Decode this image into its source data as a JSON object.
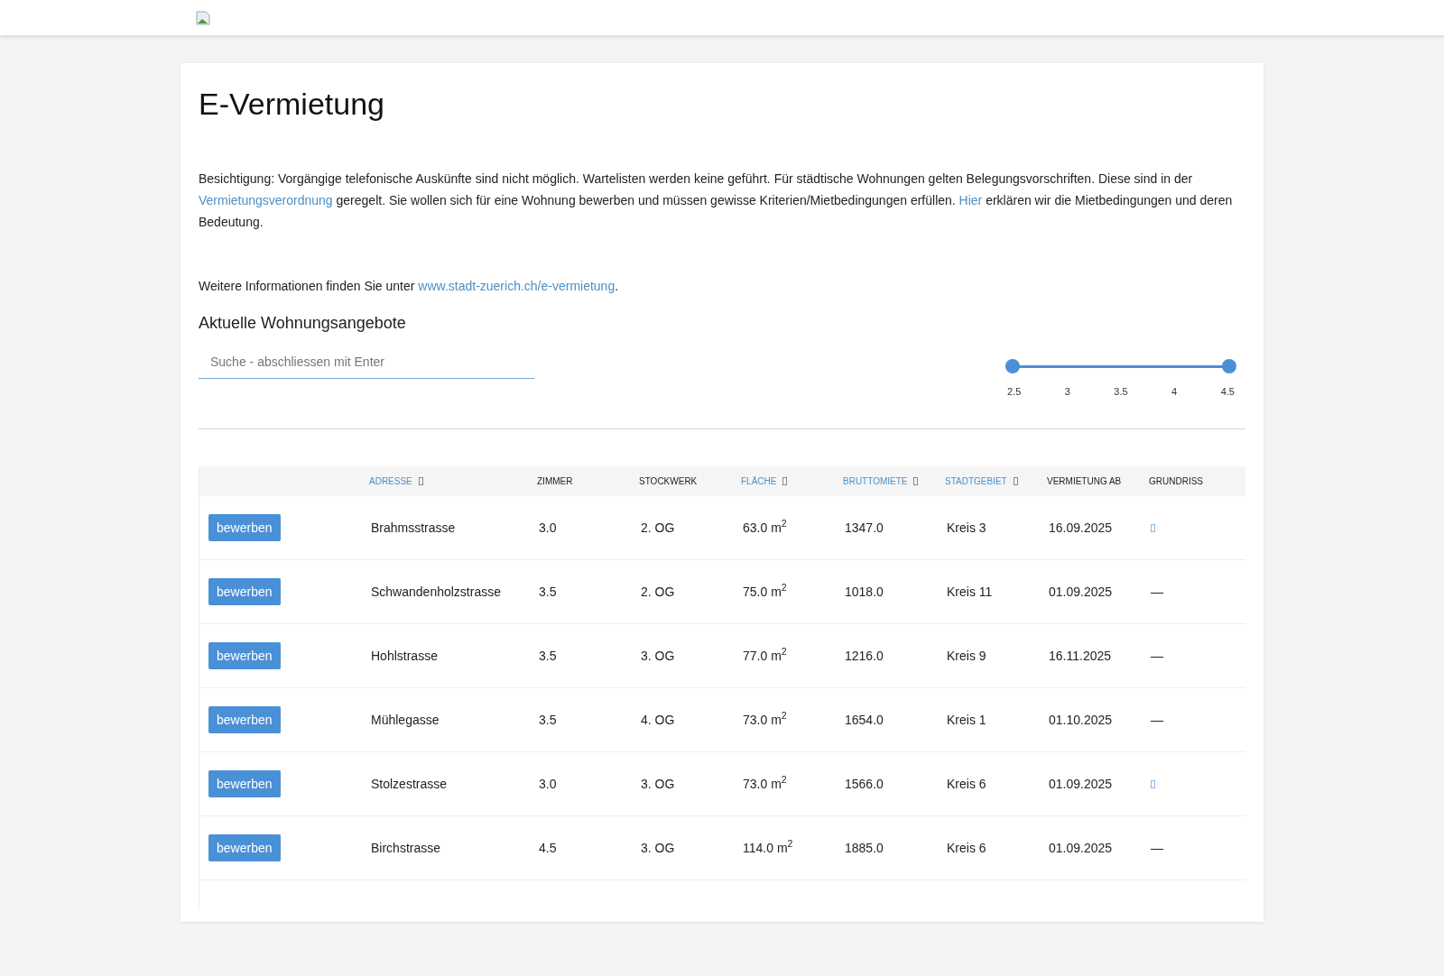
{
  "title": "E-Vermietung",
  "intro": "Besichtigung: Vorgängige telefonische Auskünfte sind nicht möglich. Wartelisten werden keine geführt. Für städtische Wohnungen gelten Belegungsvorschriften. Diese sind in der ",
  "intro_link1": "Vermietungsverordnung",
  "intro_mid": " geregelt. Sie wollen sich für eine Wohnung bewerben und müssen gewisse Kriterien/Mietbedingungen erfüllen. ",
  "intro_link2": "Hier",
  "intro_end": " erklären wir die Mietbedingungen und deren Bedeutung.",
  "info": "Weitere Informationen finden Sie unter ",
  "info_link": "www.stadt-zuerich.ch/e-vermietung",
  "info_end": ".",
  "section_title": "Aktuelle Wohnungsangebote",
  "search": {
    "placeholder": "Suche - abschliessen mit Enter"
  },
  "slider": {
    "handles": [
      {
        "level": 0
      },
      {
        "level": 1
      }
    ],
    "ticks": [
      "2.5",
      "3",
      "3.5",
      "4",
      "4.5"
    ]
  },
  "table": {
    "columns": [
      {
        "label": "ADRESSE",
        "sortable": true
      },
      {
        "label": "ZIMMER",
        "sortable": false
      },
      {
        "label": "STOCKWERK",
        "sortable": false
      },
      {
        "label": "FLÄCHE",
        "sortable": true
      },
      {
        "label": "BRUTTOMIETE",
        "sortable": true
      },
      {
        "label": "STADTGEBIET",
        "sortable": true
      },
      {
        "label": "VERMIETUNG AB",
        "sortable": false
      },
      {
        "label": "GRUNDRISS",
        "sortable": false
      }
    ],
    "rows": [
      {
        "button": "bewerben",
        "address": "Brahmsstrasse",
        "rooms": "3.0",
        "floor": "2. OG",
        "area": "63.0 m$^{2}$",
        "rent": "1347.0",
        "district": "Kreis 3",
        "available": "16.09.2025",
        "plan": {
          "kind": "icon"
        }
      },
      {
        "button": "bewerben",
        "address": "Schwandenholzstrasse",
        "rooms": "3.5",
        "floor": "2. OG",
        "area": "75.0 m$^{2}$",
        "rent": "1018.0",
        "district": "Kreis 11",
        "available": "01.09.2025",
        "plan": {
          "kind": "text",
          "text": "—"
        }
      },
      {
        "button": "bewerben",
        "address": "Hohlstrasse",
        "rooms": "3.5",
        "floor": "3. OG",
        "area": "77.0 m$^{2}$",
        "rent": "1216.0",
        "district": "Kreis 9",
        "available": "16.11.2025",
        "plan": {
          "kind": "text",
          "text": "—"
        }
      },
      {
        "button": "bewerben",
        "address": "Mühlegasse",
        "rooms": "3.5",
        "floor": "4. OG",
        "area": "73.0 m$^{2}$",
        "rent": "1654.0",
        "district": "Kreis 1",
        "available": "01.10.2025",
        "plan": {
          "kind": "text",
          "text": "—"
        }
      },
      {
        "button": "bewerben",
        "address": "Stolzestrasse",
        "rooms": "3.0",
        "floor": "3. OG",
        "area": "73.0 m$^{2}$",
        "rent": "1566.0",
        "district": "Kreis 6",
        "available": "01.09.2025",
        "plan": {
          "kind": "icon"
        }
      },
      {
        "button": "bewerben",
        "address": "Birchstrasse",
        "rooms": "4.5",
        "floor": "3. OG",
        "area": "114.0 m$^{2}$",
        "rent": "1885.0",
        "district": "Kreis 6",
        "available": "01.09.2025",
        "plan": {
          "kind": "text",
          "text": "—"
        }
      }
    ]
  }
}
